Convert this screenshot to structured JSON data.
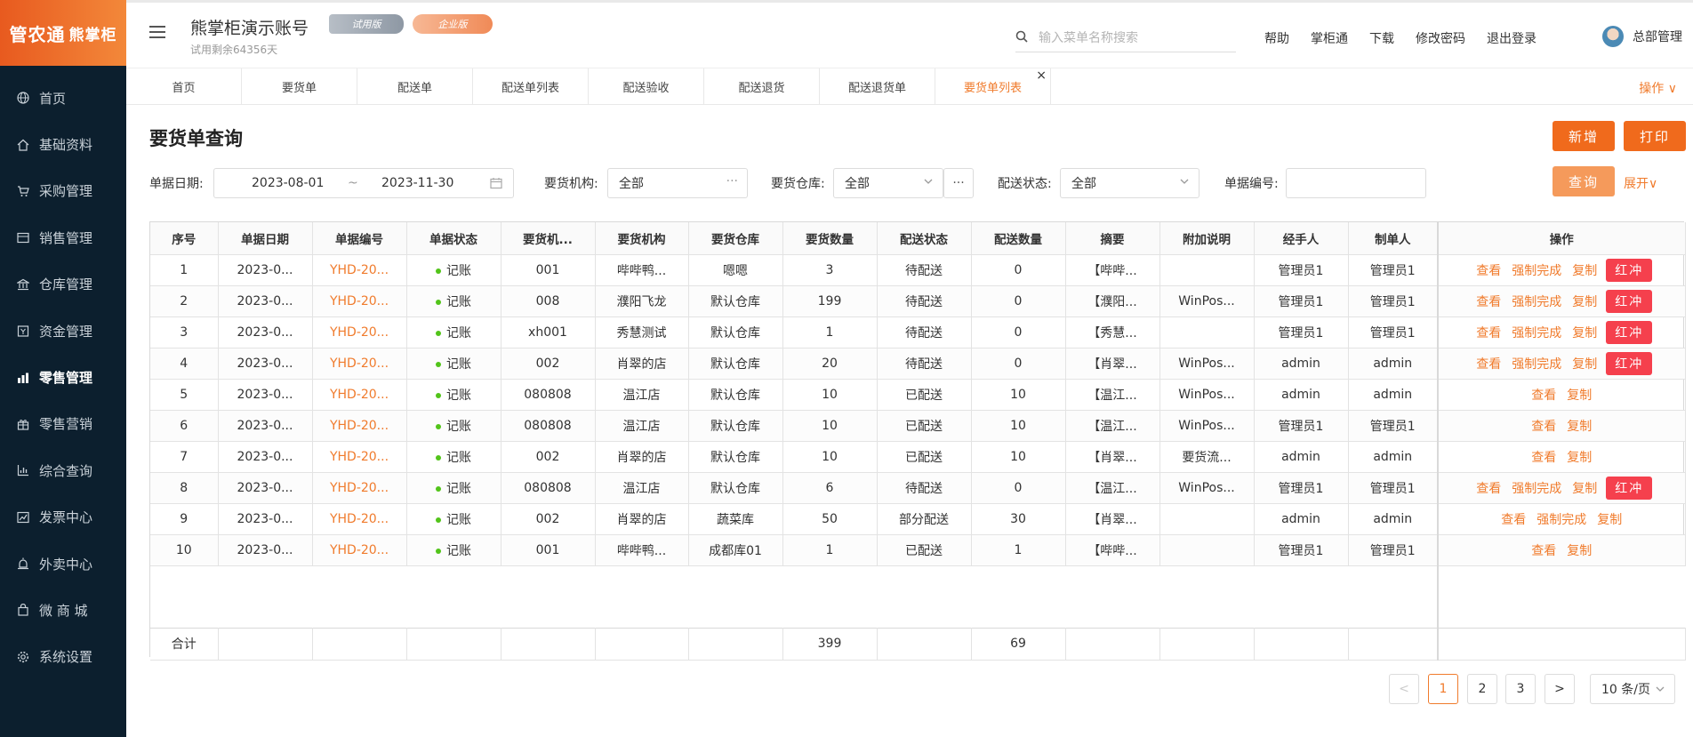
{
  "logo": {
    "brand": "管农通",
    "sub": "熊掌柜"
  },
  "sidebar": {
    "items": [
      {
        "label": "首页",
        "icon": "globe-icon"
      },
      {
        "label": "基础资料",
        "icon": "home-icon"
      },
      {
        "label": "采购管理",
        "icon": "cart-icon"
      },
      {
        "label": "销售管理",
        "icon": "calendar-icon"
      },
      {
        "label": "仓库管理",
        "icon": "bank-icon"
      },
      {
        "label": "资金管理",
        "icon": "wallet-icon"
      },
      {
        "label": "零售管理",
        "icon": "bar-chart-icon",
        "active": true
      },
      {
        "label": "零售营销",
        "icon": "gift-icon"
      },
      {
        "label": "综合查询",
        "icon": "chart-icon"
      },
      {
        "label": "发票中心",
        "icon": "trend-icon"
      },
      {
        "label": "外卖中心",
        "icon": "alarm-icon"
      },
      {
        "label": "微 商 城",
        "icon": "bag-icon"
      },
      {
        "label": "系统设置",
        "icon": "gear-icon"
      }
    ]
  },
  "header": {
    "account_title": "熊掌柜演示账号",
    "trial_text": "试用剩余64356天",
    "badge_trial": "试用版",
    "badge_enterprise": "企业版",
    "search_placeholder": "输入菜单名称搜索",
    "links": [
      "帮助",
      "掌柜通",
      "下载",
      "修改密码",
      "退出登录"
    ],
    "user": "总部管理"
  },
  "tabs": [
    {
      "label": "首页"
    },
    {
      "label": "要货单"
    },
    {
      "label": "配送单"
    },
    {
      "label": "配送单列表"
    },
    {
      "label": "配送验收"
    },
    {
      "label": "配送退货"
    },
    {
      "label": "配送退货单"
    },
    {
      "label": "要货单列表",
      "active": true
    }
  ],
  "tab_close": "×",
  "operations": "操作 ∨",
  "page": {
    "title": "要货单查询",
    "btn_new": "新增",
    "btn_print": "打印",
    "btn_query": "查询",
    "expand": "展开∨"
  },
  "filters": {
    "date_label": "单据日期:",
    "date_start": "2023-08-01",
    "date_sep": "~",
    "date_end": "2023-11-30",
    "org_label": "要货机构:",
    "org_value": "全部",
    "wh_label": "要货仓库:",
    "wh_value": "全部",
    "status_label": "配送状态:",
    "status_value": "全部",
    "no_label": "单据编号:",
    "no_value": ""
  },
  "table": {
    "headers": [
      "序号",
      "单据日期",
      "单据编号",
      "单据状态",
      "要货机...",
      "要货机构",
      "要货仓库",
      "要货数量",
      "配送状态",
      "配送数量",
      "摘要",
      "附加说明",
      "经手人",
      "制单人",
      "操作"
    ],
    "rows": [
      {
        "no": "1",
        "date": "2023-0...",
        "code": "YHD-20...",
        "status": "记账",
        "org_code": "001",
        "org": "哔哔鸭...",
        "wh": "嗯嗯",
        "qty": "3",
        "ship_status": "待配送",
        "ship_qty": "0",
        "summary": "【哔哔...",
        "note": "",
        "handler": "管理员1",
        "maker": "管理员1",
        "actions": [
          "查看",
          "强制完成",
          "复制"
        ],
        "red": "红冲"
      },
      {
        "no": "2",
        "date": "2023-0...",
        "code": "YHD-20...",
        "status": "记账",
        "org_code": "008",
        "org": "濮阳飞龙",
        "wh": "默认仓库",
        "qty": "199",
        "ship_status": "待配送",
        "ship_qty": "0",
        "summary": "【濮阳...",
        "note": "WinPos...",
        "handler": "管理员1",
        "maker": "管理员1",
        "actions": [
          "查看",
          "强制完成",
          "复制"
        ],
        "red": "红冲"
      },
      {
        "no": "3",
        "date": "2023-0...",
        "code": "YHD-20...",
        "status": "记账",
        "org_code": "xh001",
        "org": "秀慧测试",
        "wh": "默认仓库",
        "qty": "1",
        "ship_status": "待配送",
        "ship_qty": "0",
        "summary": "【秀慧...",
        "note": "",
        "handler": "管理员1",
        "maker": "管理员1",
        "actions": [
          "查看",
          "强制完成",
          "复制"
        ],
        "red": "红冲"
      },
      {
        "no": "4",
        "date": "2023-0...",
        "code": "YHD-20...",
        "status": "记账",
        "org_code": "002",
        "org": "肖翠的店",
        "wh": "默认仓库",
        "qty": "20",
        "ship_status": "待配送",
        "ship_qty": "0",
        "summary": "【肖翠...",
        "note": "WinPos...",
        "handler": "admin",
        "maker": "admin",
        "actions": [
          "查看",
          "强制完成",
          "复制"
        ],
        "red": "红冲"
      },
      {
        "no": "5",
        "date": "2023-0...",
        "code": "YHD-20...",
        "status": "记账",
        "org_code": "080808",
        "org": "温江店",
        "wh": "默认仓库",
        "qty": "10",
        "ship_status": "已配送",
        "ship_qty": "10",
        "summary": "【温江...",
        "note": "WinPos...",
        "handler": "admin",
        "maker": "admin",
        "actions": [
          "查看",
          "复制"
        ],
        "red": ""
      },
      {
        "no": "6",
        "date": "2023-0...",
        "code": "YHD-20...",
        "status": "记账",
        "org_code": "080808",
        "org": "温江店",
        "wh": "默认仓库",
        "qty": "10",
        "ship_status": "已配送",
        "ship_qty": "10",
        "summary": "【温江...",
        "note": "WinPos...",
        "handler": "管理员1",
        "maker": "管理员1",
        "actions": [
          "查看",
          "复制"
        ],
        "red": ""
      },
      {
        "no": "7",
        "date": "2023-0...",
        "code": "YHD-20...",
        "status": "记账",
        "org_code": "002",
        "org": "肖翠的店",
        "wh": "默认仓库",
        "qty": "10",
        "ship_status": "已配送",
        "ship_qty": "10",
        "summary": "【肖翠...",
        "note": "要货流...",
        "handler": "admin",
        "maker": "admin",
        "actions": [
          "查看",
          "复制"
        ],
        "red": ""
      },
      {
        "no": "8",
        "date": "2023-0...",
        "code": "YHD-20...",
        "status": "记账",
        "org_code": "080808",
        "org": "温江店",
        "wh": "默认仓库",
        "qty": "6",
        "ship_status": "待配送",
        "ship_qty": "0",
        "summary": "【温江...",
        "note": "WinPos...",
        "handler": "管理员1",
        "maker": "管理员1",
        "actions": [
          "查看",
          "强制完成",
          "复制"
        ],
        "red": "红冲"
      },
      {
        "no": "9",
        "date": "2023-0...",
        "code": "YHD-20...",
        "status": "记账",
        "org_code": "002",
        "org": "肖翠的店",
        "wh": "蔬菜库",
        "qty": "50",
        "ship_status": "部分配送",
        "ship_qty": "30",
        "summary": "【肖翠...",
        "note": "",
        "handler": "admin",
        "maker": "admin",
        "actions": [
          "查看",
          "强制完成",
          "复制"
        ],
        "red": ""
      },
      {
        "no": "10",
        "date": "2023-0...",
        "code": "YHD-20...",
        "status": "记账",
        "org_code": "001",
        "org": "哔哔鸭...",
        "wh": "成都库01",
        "qty": "1",
        "ship_status": "已配送",
        "ship_qty": "1",
        "summary": "【哔哔...",
        "note": "",
        "handler": "管理员1",
        "maker": "管理员1",
        "actions": [
          "查看",
          "复制"
        ],
        "red": ""
      }
    ],
    "sum_label": "合计",
    "sum_qty": "399",
    "sum_ship_qty": "69"
  },
  "pagination": {
    "prev": "<",
    "pages": [
      "1",
      "2",
      "3"
    ],
    "current": "1",
    "next": ">",
    "page_size": "10 条/页"
  },
  "colors": {
    "accent": "#f07b2c",
    "sidebar_bg": "#0c1f2e",
    "danger": "#f5404d",
    "success": "#52c41a"
  }
}
